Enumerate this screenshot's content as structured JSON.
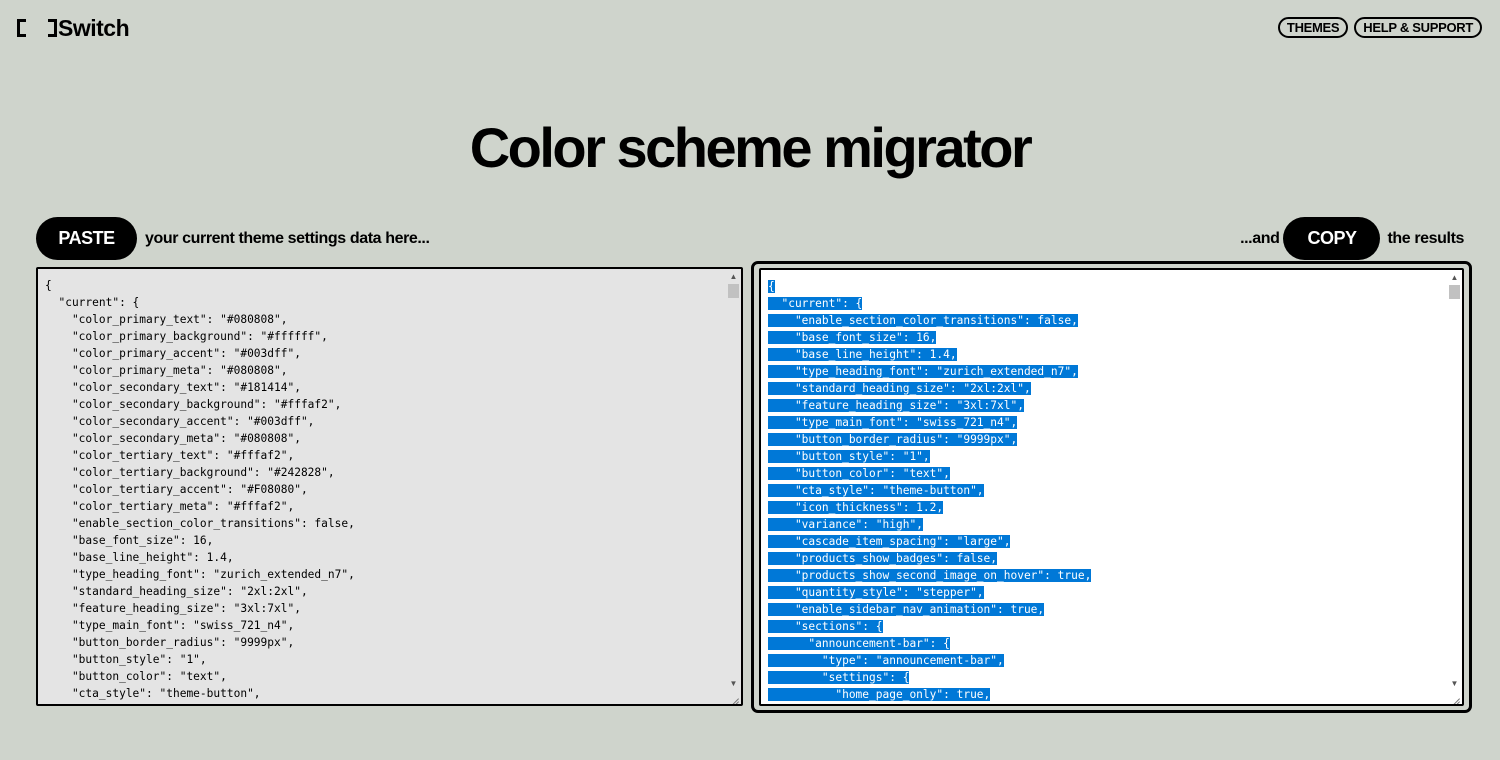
{
  "header": {
    "logo_text": "Switch",
    "nav": [
      {
        "label": "THEMES"
      },
      {
        "label": "HELP & SUPPORT"
      }
    ]
  },
  "title": "Color scheme migrator",
  "actions": {
    "paste_label": "PASTE",
    "paste_text": "your current theme settings data here...",
    "and_text": "...and",
    "copy_label": "COPY",
    "results_text": "the results"
  },
  "input_lines": [
    "{",
    "  \"current\": {",
    "    \"color_primary_text\": \"#080808\",",
    "    \"color_primary_background\": \"#ffffff\",",
    "    \"color_primary_accent\": \"#003dff\",",
    "    \"color_primary_meta\": \"#080808\",",
    "    \"color_secondary_text\": \"#181414\",",
    "    \"color_secondary_background\": \"#fffaf2\",",
    "    \"color_secondary_accent\": \"#003dff\",",
    "    \"color_secondary_meta\": \"#080808\",",
    "    \"color_tertiary_text\": \"#fffaf2\",",
    "    \"color_tertiary_background\": \"#242828\",",
    "    \"color_tertiary_accent\": \"#F08080\",",
    "    \"color_tertiary_meta\": \"#fffaf2\",",
    "    \"enable_section_color_transitions\": false,",
    "    \"base_font_size\": 16,",
    "    \"base_line_height\": 1.4,",
    "    \"type_heading_font\": \"zurich_extended_n7\",",
    "    \"standard_heading_size\": \"2xl:2xl\",",
    "    \"feature_heading_size\": \"3xl:7xl\",",
    "    \"type_main_font\": \"swiss_721_n4\",",
    "    \"button_border_radius\": \"9999px\",",
    "    \"button_style\": \"1\",",
    "    \"button_color\": \"text\",",
    "    \"cta_style\": \"theme-button\","
  ],
  "output_lines": [
    "{",
    "  \"current\": {",
    "    \"enable_section_color_transitions\": false,",
    "    \"base_font_size\": 16,",
    "    \"base_line_height\": 1.4,",
    "    \"type_heading_font\": \"zurich_extended_n7\",",
    "    \"standard_heading_size\": \"2xl:2xl\",",
    "    \"feature_heading_size\": \"3xl:7xl\",",
    "    \"type_main_font\": \"swiss_721_n4\",",
    "    \"button_border_radius\": \"9999px\",",
    "    \"button_style\": \"1\",",
    "    \"button_color\": \"text\",",
    "    \"cta_style\": \"theme-button\",",
    "    \"icon_thickness\": 1.2,",
    "    \"variance\": \"high\",",
    "    \"cascade_item_spacing\": \"large\",",
    "    \"products_show_badges\": false,",
    "    \"products_show_second_image_on_hover\": true,",
    "    \"quantity_style\": \"stepper\",",
    "    \"enable_sidebar_nav_animation\": true,",
    "    \"sections\": {",
    "      \"announcement-bar\": {",
    "        \"type\": \"announcement-bar\",",
    "        \"settings\": {",
    "          \"home_page_only\": true,"
  ],
  "colors": {
    "background": "#cfd4cc",
    "selection": "#0078d7",
    "input_bg": "#e4e4e4",
    "output_bg": "#ffffff"
  },
  "icons": {
    "scroll_up": "triangle-up",
    "scroll_down": "triangle-down"
  }
}
